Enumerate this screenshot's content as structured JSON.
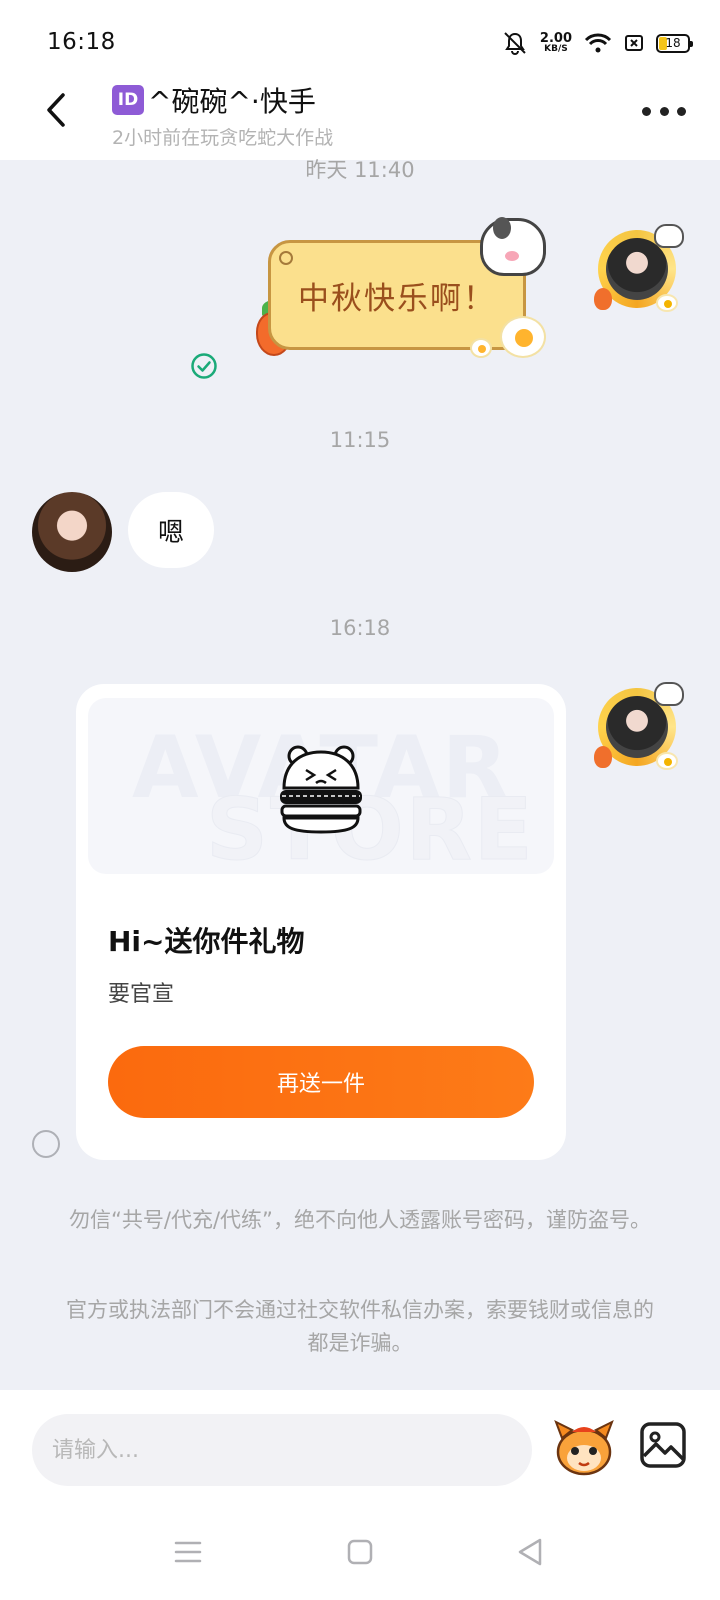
{
  "status_bar": {
    "time": "16:18",
    "net_speed_value": "2.00",
    "net_speed_unit": "KB/S",
    "battery_level": "18"
  },
  "header": {
    "id_badge": "ID",
    "title": "^碗碗^·快手",
    "subtitle": "2小时前在玩贪吃蛇大作战"
  },
  "messages": {
    "time_1": "昨天 11:40",
    "sticker_text": "中秋快乐啊！",
    "time_2": "11:15",
    "incoming_text": "嗯",
    "time_3": "16:18"
  },
  "gift_card": {
    "watermark_line1": "AVATAR",
    "watermark_line2": "STORE",
    "title": "Hi~送你件礼物",
    "description": "要官宣",
    "button_label": "再送一件"
  },
  "notices": {
    "notice_1": "勿信“共号/代充/代练”，绝不向他人透露账号密码，谨防盗号。",
    "notice_2": "官方或执法部门不会通过社交软件私信办案，索要钱财或信息的都是诈骗。"
  },
  "input": {
    "placeholder": "请输入..."
  },
  "colors": {
    "accent_orange": "#fb6a0e",
    "read_check_green": "#1aaa78",
    "sticker_yellow": "#fbe08d"
  },
  "icons": [
    "back-arrow-icon",
    "more-icon",
    "read-check-icon",
    "mascot-icon",
    "image-icon",
    "menu-icon",
    "home-icon",
    "back-nav-icon"
  ]
}
